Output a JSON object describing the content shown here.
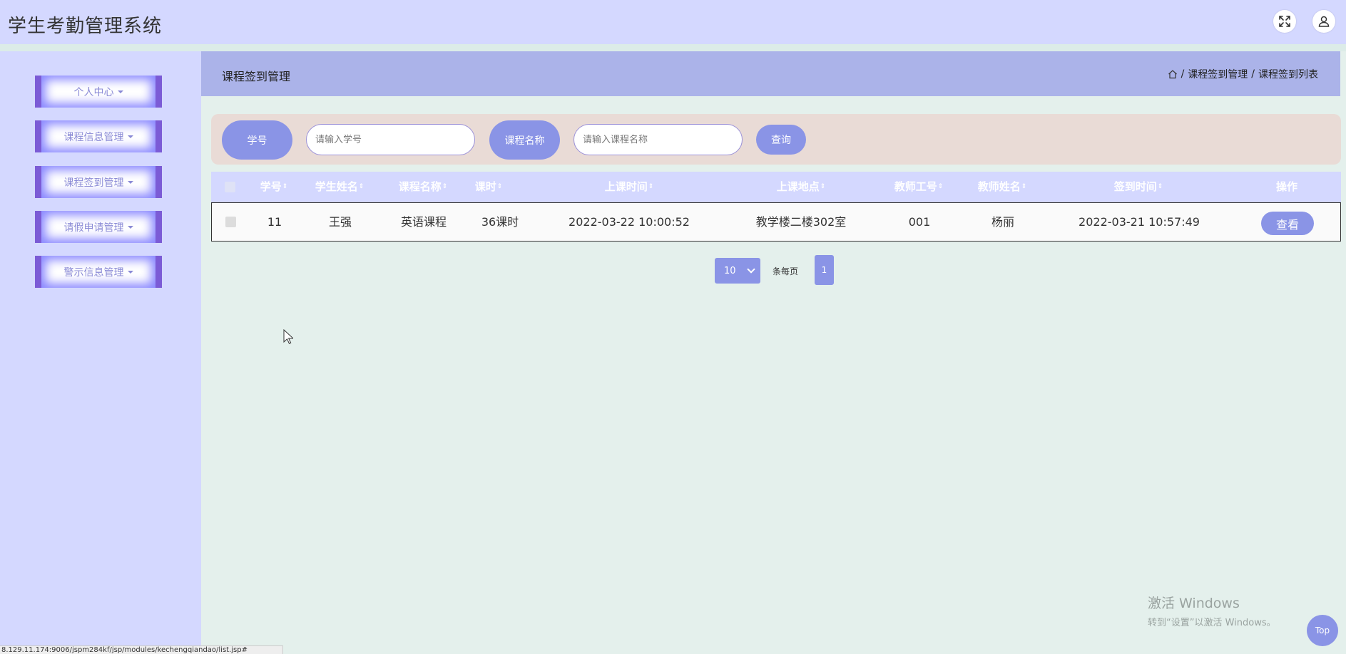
{
  "app": {
    "title": "学生考勤管理系统"
  },
  "header": {
    "fullscreen_icon": "expand-icon",
    "user_icon": "user-icon"
  },
  "sidebar": {
    "items": [
      {
        "label": "个人中心"
      },
      {
        "label": "课程信息管理"
      },
      {
        "label": "课程签到管理"
      },
      {
        "label": "请假申请管理"
      },
      {
        "label": "警示信息管理"
      }
    ]
  },
  "breadcrumb": {
    "title": "课程签到管理",
    "home_icon": "home-icon",
    "separator": "/",
    "path": [
      "课程签到管理",
      "课程签到列表"
    ]
  },
  "search": {
    "student_id_label": "学号",
    "student_id_placeholder": "请输入学号",
    "course_name_label": "课程名称",
    "course_name_placeholder": "请输入课程名称",
    "query_button": "查询"
  },
  "table": {
    "columns": [
      {
        "label": "学号",
        "sort": "⇕"
      },
      {
        "label": "学生姓名",
        "sort": "⇕"
      },
      {
        "label": "课程名称",
        "sort": "⇕"
      },
      {
        "label": "课时",
        "sort": "⇕"
      },
      {
        "label": "上课时间",
        "sort": "⇕"
      },
      {
        "label": "上课地点",
        "sort": "⇕"
      },
      {
        "label": "教师工号",
        "sort": "⇕"
      },
      {
        "label": "教师姓名",
        "sort": "⇕"
      },
      {
        "label": "签到时间",
        "sort": "⇕"
      },
      {
        "label": "操作",
        "sort": ""
      }
    ],
    "rows": [
      {
        "cells": [
          "11",
          "王强",
          "英语课程",
          "36课时",
          "2022-03-22 10:00:52",
          "教学楼二楼302室",
          "001",
          "杨丽",
          "2022-03-21 10:57:49"
        ],
        "action": "查看"
      }
    ]
  },
  "pagination": {
    "page_size": "10",
    "per_page_label": "条每页",
    "current_page": "1"
  },
  "watermark": {
    "line1": "激活 Windows",
    "line2": "转到“设置”以激活 Windows。"
  },
  "top_button": "Top",
  "status_url": "8.129.11.174:9006/jspm284kf/jsp/modules/kechengqiandao/list.jsp#"
}
